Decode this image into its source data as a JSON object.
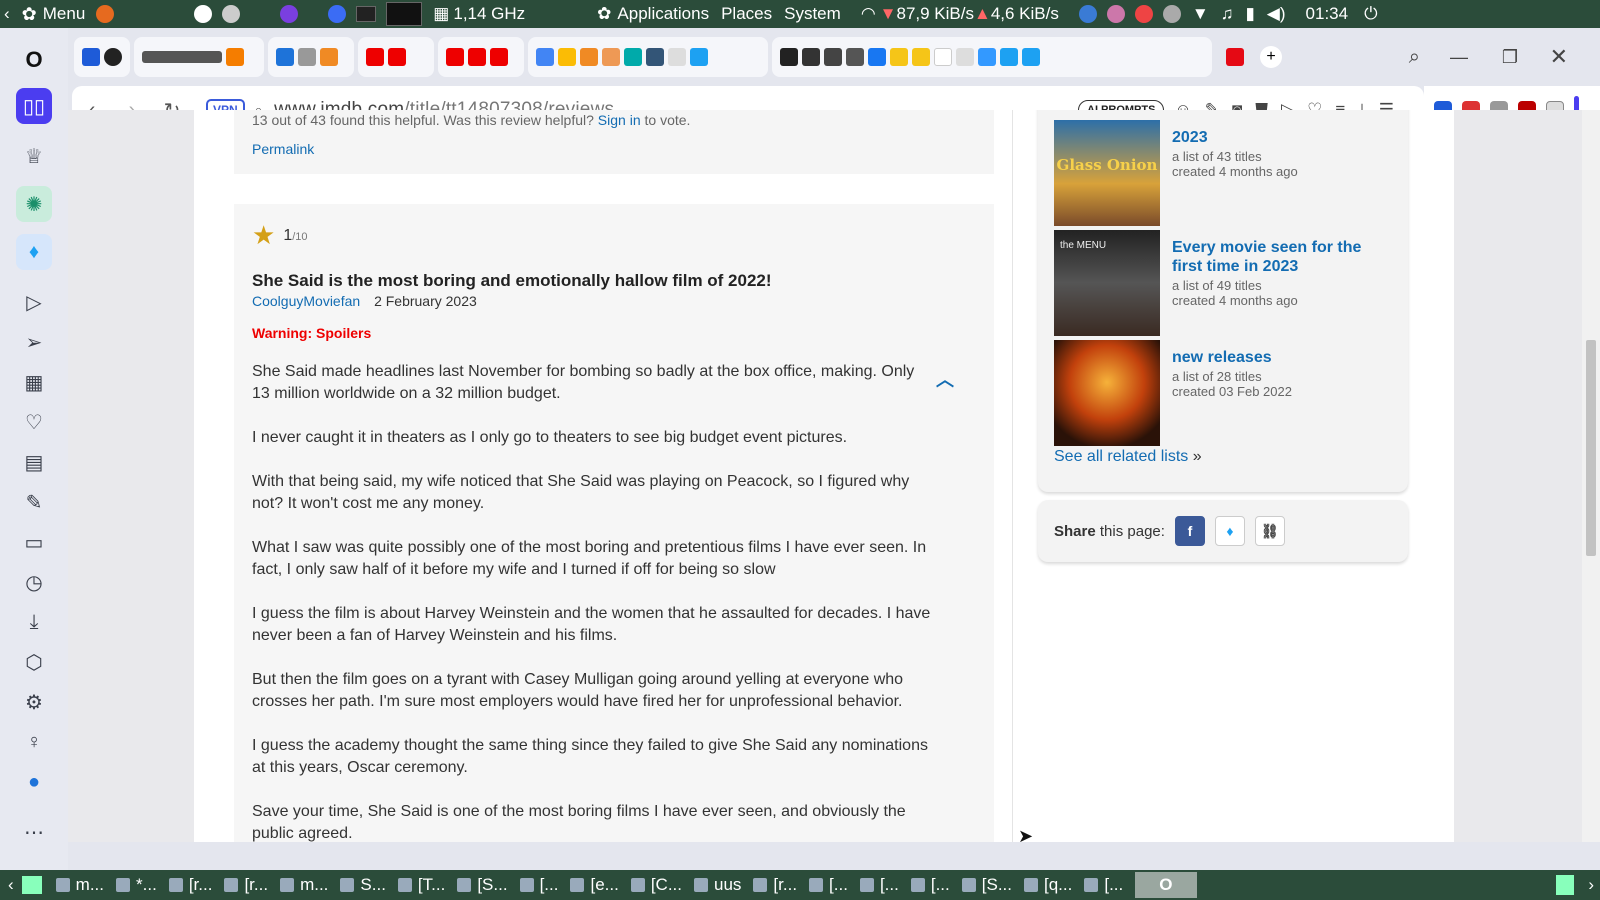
{
  "system_bar": {
    "menu_label": "Menu",
    "cpu_freq": "1,14 GHz",
    "applications": "Applications",
    "places": "Places",
    "system": "System",
    "net_down": "87,9 KiB/s",
    "net_up": "4,6 KiB/s",
    "clock": "01:34"
  },
  "browser": {
    "url_host": "www.imdb.com",
    "url_path": "/title/tt14807308/reviews",
    "vpn_label": "VPN",
    "ai_prompts_label": "AI PROMPTS"
  },
  "review_prev": {
    "helpful_text": "13 out of 43 found this helpful. Was this review helpful?",
    "sign_in": "Sign in",
    "to_vote": "to vote.",
    "permalink": "Permalink"
  },
  "review": {
    "rating": "1",
    "rating_max": "/10",
    "title": "She Said is the most boring and emotionally hallow film of 2022!",
    "author": "CoolguyMoviefan",
    "date": "2 February 2023",
    "warning": "Warning: Spoilers",
    "paragraphs": [
      "She Said made headlines last November for bombing so badly at the box office, making. Only 13 million worldwide on a 32 million budget.",
      "I never caught it in theaters as I only go to theaters to see big budget event pictures.",
      "With that being said, my wife noticed that She Said was playing on Peacock, so I figured why not? It won't cost me any money.",
      "What I saw was quite possibly one of the most boring and pretentious films I have ever seen. In fact, I only saw half of it before my wife and I turned if off for being so slow",
      "I guess the film is about Harvey Weinstein and the women that he assaulted for decades. I have never been a fan of Harvey Weinstein and his films.",
      "But then the film goes on a tyrant with Casey Mulligan going around yelling at everyone who crosses her path. I'm sure most employers would have fired her for unprofessional behavior.",
      "I guess the academy thought the same thing since they failed to give She Said any nominations at this years, Oscar ceremony.",
      "Save your time, She Said is one of the most boring films I have ever seen, and obviously the public agreed."
    ]
  },
  "related_lists": [
    {
      "title": "2023",
      "count": "a list of 43 titles",
      "created": "created 4 months ago",
      "poster_text": "Glass Onion"
    },
    {
      "title": "Every movie seen for the first time in 2023",
      "count": "a list of 49 titles",
      "created": "created 4 months ago",
      "poster_text": "the MENU"
    },
    {
      "title": "new releases",
      "count": "a list of 28 titles",
      "created": "created 03 Feb 2022",
      "poster_text": ""
    }
  ],
  "see_all": "See all related lists",
  "see_all_suffix": "»",
  "share": {
    "bold": "Share",
    "rest": "this page:"
  },
  "taskbar": [
    "m...",
    "*...",
    "[r...",
    "[r...",
    "m...",
    "S...",
    "[T...",
    "[S...",
    "[...",
    "[e...",
    "[C...",
    "uus",
    "[r...",
    "[...",
    "[...",
    "[...",
    "[S...",
    "[q...",
    "[..."
  ]
}
